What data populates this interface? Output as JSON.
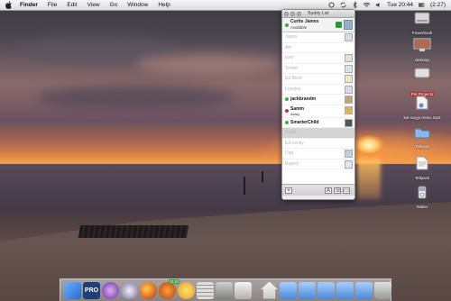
{
  "menubar": {
    "app_name": "Finder",
    "items": [
      "File",
      "Edit",
      "View",
      "Go",
      "Window",
      "Help"
    ],
    "clock": "Tue 20:44",
    "battery": "(2:27)"
  },
  "buddy_list": {
    "title": "Buddy List",
    "me": {
      "name": "Curtis James",
      "status": "Available"
    },
    "buddies": [
      {
        "name": "Jason",
        "online": false
      },
      {
        "name": "Abi",
        "online": false
      },
      {
        "name": "jono",
        "online": false
      },
      {
        "name": "Simon",
        "online": false
      },
      {
        "name": "Ed Birch",
        "online": false
      },
      {
        "name": "Lovejoy",
        "online": false
      },
      {
        "name": "jackbrandm",
        "online": true,
        "status_color": "#3cae3c"
      },
      {
        "name": "Samm",
        "online": true,
        "sub": "Away",
        "status_color": "#cc3333"
      },
      {
        "name": "SmarterChild",
        "online": true,
        "status_color": "#3cae3c"
      },
      {
        "name": "Grant",
        "online": false,
        "selected": true
      },
      {
        "name": "Ed Lecky",
        "online": false
      },
      {
        "name": "Dad",
        "online": false
      },
      {
        "name": "Rupert",
        "online": false
      }
    ],
    "footer_add": "+"
  },
  "desktop_icons": [
    {
      "label": "Powerbook",
      "icon": "hard-drive-icon",
      "highlight": false
    },
    {
      "label": "desktop",
      "icon": "monitor-icon",
      "highlight": false
    },
    {
      "label": "Pet Projects",
      "icon": "drive-icon",
      "highlight": true
    },
    {
      "label": "kat-vargo.remix.mp3",
      "icon": "audio-file-icon",
      "highlight": false
    },
    {
      "label": "Tellspot",
      "icon": "folder-icon",
      "highlight": false
    },
    {
      "label": "Tellpack",
      "icon": "document-icon",
      "highlight": false
    },
    {
      "label": "Walter",
      "icon": "ipod-icon",
      "highlight": false
    }
  ],
  "dock": {
    "items": [
      "finder-icon",
      "pro-app-icon",
      "purple-app-icon",
      "circle-app-icon",
      "firefox-icon",
      "badge-app-icon",
      "aim-icon",
      "calculator-icon",
      "system-preferences-icon",
      "apple-app-icon",
      "home-folder-icon",
      "folder-icon",
      "folder-icon",
      "folder-icon",
      "folder-icon",
      "folder-icon",
      "trash-icon"
    ],
    "badge": "3130"
  },
  "colors": {
    "menubar": "#e6e6e6",
    "online": "#3cae3c",
    "away": "#cc3333",
    "highlight": "#c23a3a"
  }
}
